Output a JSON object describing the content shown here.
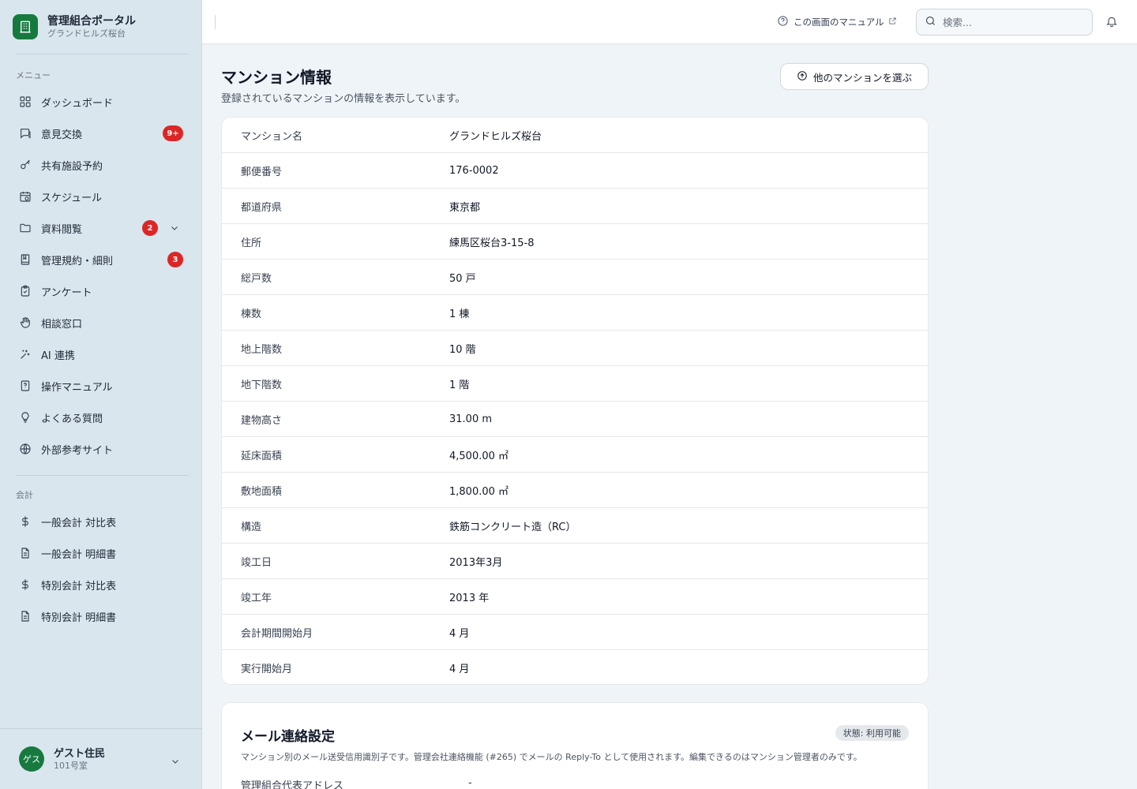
{
  "brand": {
    "title": "管理組合ポータル",
    "subtitle": "グランドヒルズ桜台"
  },
  "sidebar": {
    "menu_label": "メニュー",
    "items": [
      {
        "label": "ダッシュボード",
        "icon": "grid-icon"
      },
      {
        "label": "意見交換",
        "icon": "chat-icon",
        "badge": "9+"
      },
      {
        "label": "共有施設予約",
        "icon": "key-icon"
      },
      {
        "label": "スケジュール",
        "icon": "calendar-icon"
      },
      {
        "label": "資料閲覧",
        "icon": "folder-icon",
        "badge": "2"
      },
      {
        "label": "管理規約・細則",
        "icon": "book-icon",
        "badge": "3"
      },
      {
        "label": "アンケート",
        "icon": "clipboard-icon"
      },
      {
        "label": "相談窓口",
        "icon": "hand-icon"
      },
      {
        "label": "AI 連携",
        "icon": "sparkle-icon"
      },
      {
        "label": "操作マニュアル",
        "icon": "manual-icon"
      },
      {
        "label": "よくある質問",
        "icon": "lightbulb-icon"
      },
      {
        "label": "外部参考サイト",
        "icon": "globe-icon"
      }
    ],
    "accounting_label": "会計",
    "accounting_items": [
      {
        "label": "一般会計 対比表",
        "icon": "dollar-icon"
      },
      {
        "label": "一般会計 明細書",
        "icon": "document-icon"
      },
      {
        "label": "特別会計 対比表",
        "icon": "dollar-icon"
      },
      {
        "label": "特別会計 明細書",
        "icon": "document-icon"
      }
    ]
  },
  "user": {
    "avatar": "ゲス",
    "name": "ゲスト住民",
    "room": "101号室"
  },
  "header": {
    "manual_link": "この画面のマニュアル",
    "search_placeholder": "検索..."
  },
  "main": {
    "title": "マンション情報",
    "subtitle": "登録されているマンションの情報を表示しています。",
    "choose_button": "他のマンションを選ぶ",
    "info_rows": [
      {
        "key": "マンション名",
        "value": "グランドヒルズ桜台"
      },
      {
        "key": "郵便番号",
        "value": "176-0002"
      },
      {
        "key": "都道府県",
        "value": "東京都"
      },
      {
        "key": "住所",
        "value": "練馬区桜台3-15-8"
      },
      {
        "key": "総戸数",
        "value": "50 戸"
      },
      {
        "key": "棟数",
        "value": "1 棟"
      },
      {
        "key": "地上階数",
        "value": "10 階"
      },
      {
        "key": "地下階数",
        "value": "1 階"
      },
      {
        "key": "建物高さ",
        "value": "31.00 m"
      },
      {
        "key": "延床面積",
        "value": "4,500.00 ㎡"
      },
      {
        "key": "敷地面積",
        "value": "1,800.00 ㎡"
      },
      {
        "key": "構造",
        "value": "鉄筋コンクリート造（RC）"
      },
      {
        "key": "竣工日",
        "value": "2013年3月"
      },
      {
        "key": "竣工年",
        "value": "2013 年"
      },
      {
        "key": "会計期間開始月",
        "value": "4 月"
      },
      {
        "key": "実行開始月",
        "value": "4 月"
      }
    ],
    "mail": {
      "title": "メール連絡設定",
      "status": "状態: 利用可能",
      "description": "マンション別のメール送受信用識別子です。管理会社連絡機能 (#265) でメールの Reply-To として使用されます。編集できるのはマンション管理者のみです。",
      "row_key": "管理組合代表アドレス",
      "row_value": "-"
    }
  },
  "colors": {
    "brand": "#167a3f",
    "badge": "#dc2626",
    "sidebar_bg": "#dae6ee",
    "page_bg": "#eef4f7"
  }
}
